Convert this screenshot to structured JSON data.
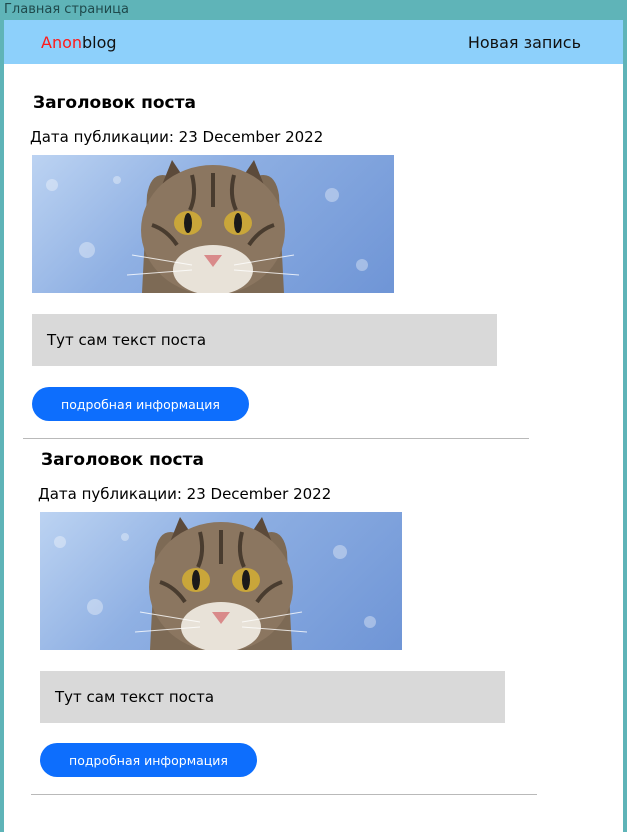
{
  "frame": {
    "label": "Главная страница"
  },
  "navbar": {
    "brand_part1": "Anon",
    "brand_part2": "blog",
    "new_post": "Новая запись"
  },
  "posts": [
    {
      "title": "Заголовок поста",
      "date": "Дата публикации: 23 December 2022",
      "text": "Тут сам текст поста",
      "button": "подробная информация"
    },
    {
      "title": "Заголовок поста",
      "date": "Дата публикации: 23 December 2022",
      "text": "Тут сам текст поста",
      "button": "подробная информация"
    }
  ],
  "colors": {
    "navbar": "#8dd0fb",
    "brand_accent": "#ff1a1a",
    "button": "#0d6efd",
    "text_box": "#d9d9d9"
  }
}
